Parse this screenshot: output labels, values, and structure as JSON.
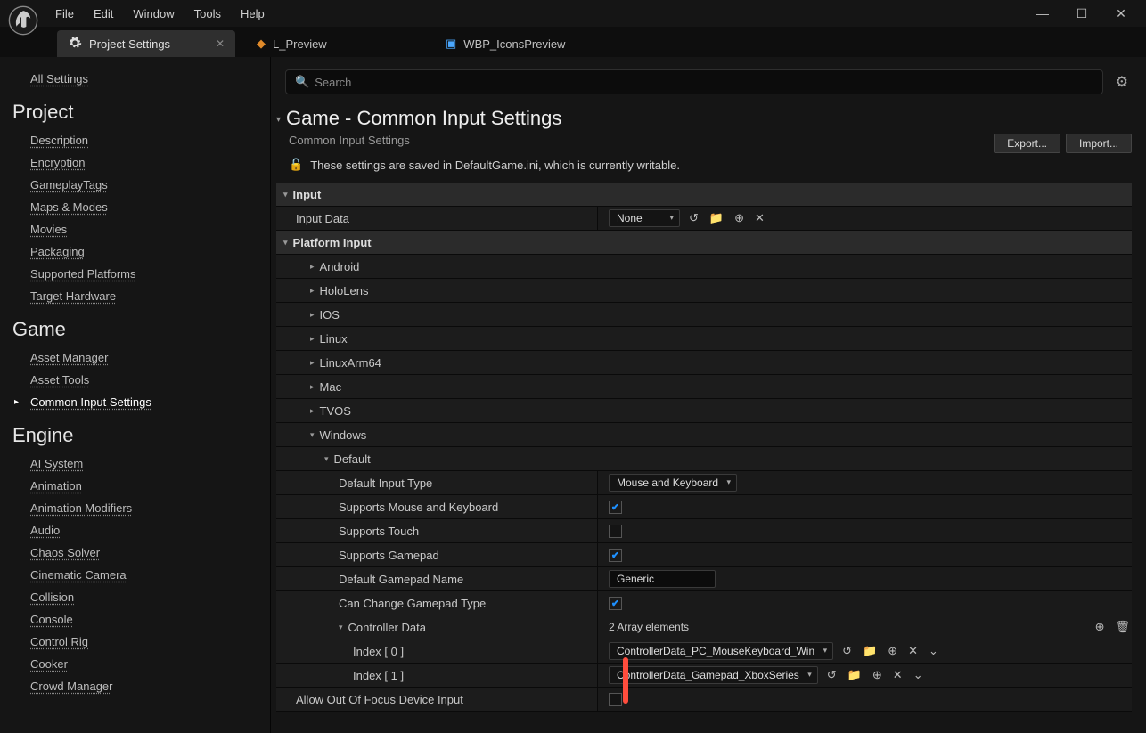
{
  "menu": {
    "file": "File",
    "edit": "Edit",
    "window": "Window",
    "tools": "Tools",
    "help": "Help"
  },
  "tabs": {
    "t0": "Project Settings",
    "t1": "L_Preview",
    "t2": "WBP_IconsPreview"
  },
  "sidebar": {
    "all": "All Settings",
    "project_head": "Project",
    "project": [
      "Description",
      "Encryption",
      "GameplayTags",
      "Maps & Modes",
      "Movies",
      "Packaging",
      "Supported Platforms",
      "Target Hardware"
    ],
    "game_head": "Game",
    "game": [
      "Asset Manager",
      "Asset Tools",
      "Common Input Settings"
    ],
    "engine_head": "Engine",
    "engine": [
      "AI System",
      "Animation",
      "Animation Modifiers",
      "Audio",
      "Chaos Solver",
      "Cinematic Camera",
      "Collision",
      "Console",
      "Control Rig",
      "Cooker",
      "Crowd Manager"
    ]
  },
  "content": {
    "search_ph": "Search",
    "title": "Game - Common Input Settings",
    "subtitle": "Common Input Settings",
    "export": "Export...",
    "import": "Import...",
    "saved": "These settings are saved in DefaultGame.ini, which is currently writable."
  },
  "sections": {
    "input": "Input",
    "input_data": "Input Data",
    "none": "None",
    "platform": "Platform Input",
    "platforms": [
      "Android",
      "HoloLens",
      "IOS",
      "Linux",
      "LinuxArm64",
      "Mac",
      "TVOS",
      "Windows"
    ],
    "default": "Default",
    "rows": {
      "dit": "Default Input Type",
      "dit_val": "Mouse and Keyboard",
      "smk": "Supports Mouse and Keyboard",
      "st": "Supports Touch",
      "sg": "Supports Gamepad",
      "dgn": "Default Gamepad Name",
      "dgn_val": "Generic",
      "ccgt": "Can Change Gamepad Type",
      "cd": "Controller Data",
      "cd_count": "2 Array elements",
      "idx0": "Index [ 0 ]",
      "idx0_val": "ControllerData_PC_MouseKeyboard_Win",
      "idx1": "Index [ 1 ]",
      "idx1_val": "ControllerData_Gamepad_XboxSeries",
      "allow": "Allow Out Of Focus Device Input"
    }
  }
}
